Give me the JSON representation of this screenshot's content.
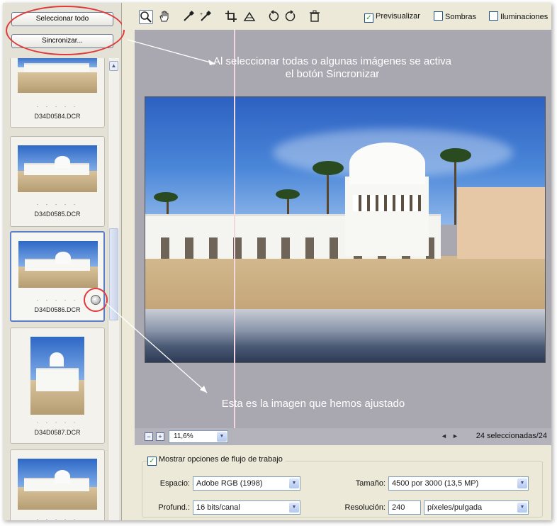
{
  "left_panel": {
    "select_all_label": "Seleccionar todo",
    "sync_label": "Sincronizar...",
    "thumbnails": [
      {
        "label": "D34D0584.DCR",
        "dots": ". . . . ."
      },
      {
        "label": "D34D0585.DCR",
        "dots": ". . . . ."
      },
      {
        "label": "D34D0586.DCR",
        "dots": ". . . . ."
      },
      {
        "label": "D34D0587.DCR",
        "dots": ". . . . ."
      },
      {
        "label": "",
        "dots": ". . . . ."
      }
    ]
  },
  "toolbar": {
    "tools": [
      "zoom-icon",
      "hand-icon",
      "eyedropper-icon",
      "color-sampler-icon",
      "crop-icon",
      "straighten-icon",
      "rotate-left-icon",
      "rotate-right-icon",
      "trash-icon"
    ],
    "preview_label": "Previsualizar",
    "shadows_label": "Sombras",
    "highlights_label": "Iluminaciones"
  },
  "annotations": {
    "top": "Al seleccionar todas o algunas imágenes se activa el botón Sincronizar",
    "bottom": "Esta es la imagen que hemos ajustado"
  },
  "statusbar": {
    "zoom_out": "−",
    "zoom_in": "+",
    "zoom_value": "11,6%",
    "prev": "◄",
    "next": "►",
    "selected": "24 seleccionadas/24"
  },
  "workflow": {
    "show_label": "Mostrar opciones de flujo de trabajo",
    "space_label": "Espacio:",
    "space_value": "Adobe RGB (1998)",
    "depth_label": "Profund.:",
    "depth_value": "16 bits/canal",
    "size_label": "Tamaño:",
    "size_value": "4500 por 3000  (13,5 MP)",
    "resolution_label": "Resolución:",
    "resolution_value": "240",
    "resolution_unit": "píxeles/pulgada"
  },
  "colors": {
    "accent_red": "#e03a3a",
    "selection_blue": "#5a7ec9",
    "preview_bg": "#a9a8b1"
  }
}
